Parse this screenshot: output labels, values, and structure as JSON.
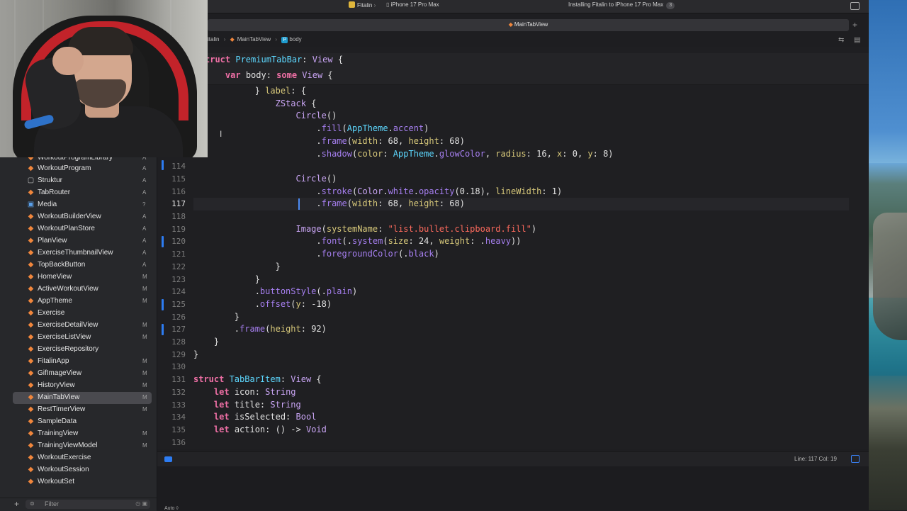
{
  "window": {
    "scheme": "Fitalin",
    "destination": "iPhone 17 Pro Max",
    "activity": "Installing Fitalin to iPhone 17 Pro Max",
    "activity_count": "3"
  },
  "tab": {
    "title": "MainTabView"
  },
  "jumpbar": {
    "project": "italin",
    "file": "MainTabView",
    "symbol": "body",
    "symbol_icon": "P"
  },
  "sidebar": {
    "items": [
      {
        "name": "WorkoutProgramLibrary",
        "status": "A",
        "kind": "swift"
      },
      {
        "name": "WorkoutProgram",
        "status": "A",
        "kind": "swift"
      },
      {
        "name": "Struktur",
        "status": "A",
        "kind": "folder"
      },
      {
        "name": "TabRouter",
        "status": "A",
        "kind": "swift"
      },
      {
        "name": "Media",
        "status": "?",
        "kind": "asset"
      },
      {
        "name": "WorkoutBuilderView",
        "status": "A",
        "kind": "swift"
      },
      {
        "name": "WorkoutPlanStore",
        "status": "A",
        "kind": "swift"
      },
      {
        "name": "PlanView",
        "status": "A",
        "kind": "swift"
      },
      {
        "name": "ExerciseThumbnailView",
        "status": "A",
        "kind": "swift"
      },
      {
        "name": "TopBackButton",
        "status": "A",
        "kind": "swift"
      },
      {
        "name": "HomeView",
        "status": "M",
        "kind": "swift"
      },
      {
        "name": "ActiveWorkoutView",
        "status": "M",
        "kind": "swift"
      },
      {
        "name": "AppTheme",
        "status": "M",
        "kind": "swift"
      },
      {
        "name": "Exercise",
        "status": "",
        "kind": "swift"
      },
      {
        "name": "ExerciseDetailView",
        "status": "M",
        "kind": "swift"
      },
      {
        "name": "ExerciseListView",
        "status": "M",
        "kind": "swift"
      },
      {
        "name": "ExerciseRepository",
        "status": "",
        "kind": "swift"
      },
      {
        "name": "FitalinApp",
        "status": "M",
        "kind": "swift"
      },
      {
        "name": "GifImageView",
        "status": "M",
        "kind": "swift"
      },
      {
        "name": "HistoryView",
        "status": "M",
        "kind": "swift"
      },
      {
        "name": "MainTabView",
        "status": "M",
        "kind": "swift",
        "selected": true
      },
      {
        "name": "RestTimerView",
        "status": "M",
        "kind": "swift"
      },
      {
        "name": "SampleData",
        "status": "",
        "kind": "swift"
      },
      {
        "name": "TrainingView",
        "status": "M",
        "kind": "swift"
      },
      {
        "name": "TrainingViewModel",
        "status": "M",
        "kind": "swift"
      },
      {
        "name": "WorkoutExercise",
        "status": "",
        "kind": "swift"
      },
      {
        "name": "WorkoutSession",
        "status": "",
        "kind": "swift"
      },
      {
        "name": "WorkoutSet",
        "status": "",
        "kind": "swift"
      }
    ],
    "filter_placeholder": "Filter"
  },
  "sticky_header": [
    [
      [
        "kw",
        "truct "
      ],
      [
        "ty",
        "PremiumTabBar"
      ],
      [
        "pl",
        ": "
      ],
      [
        "tp",
        "View"
      ],
      [
        "pl",
        " {"
      ]
    ],
    [
      [
        "pl",
        "    "
      ],
      [
        "kw",
        "var "
      ],
      [
        "pl",
        "body: "
      ],
      [
        "kw",
        "some "
      ],
      [
        "tp",
        "View"
      ],
      [
        "pl",
        " {"
      ]
    ]
  ],
  "code_lines": [
    {
      "n": "",
      "seg": [
        [
          "pl",
          "            } "
        ],
        [
          "nm",
          "label"
        ],
        [
          "pl",
          ": {"
        ]
      ]
    },
    {
      "n": "",
      "seg": [
        [
          "pl",
          "                "
        ],
        [
          "tp",
          "ZStack"
        ],
        [
          "pl",
          " {"
        ]
      ]
    },
    {
      "n": "",
      "seg": [
        [
          "pl",
          "                    "
        ],
        [
          "tp",
          "Circle"
        ],
        [
          "pl",
          "()"
        ]
      ]
    },
    {
      "n": "",
      "seg": [
        [
          "pl",
          "                        ."
        ],
        [
          "mt",
          "fill"
        ],
        [
          "pl",
          "("
        ],
        [
          "ty",
          "AppTheme"
        ],
        [
          "pl",
          "."
        ],
        [
          "mt",
          "accent"
        ],
        [
          "pl",
          ")"
        ]
      ]
    },
    {
      "n": "",
      "seg": [
        [
          "pl",
          "                        ."
        ],
        [
          "mt",
          "frame"
        ],
        [
          "pl",
          "("
        ],
        [
          "nm",
          "width"
        ],
        [
          "pl",
          ": 68, "
        ],
        [
          "nm",
          "height"
        ],
        [
          "pl",
          ": 68)"
        ]
      ]
    },
    {
      "n": "",
      "seg": [
        [
          "pl",
          "                        ."
        ],
        [
          "mt",
          "shadow"
        ],
        [
          "pl",
          "("
        ],
        [
          "nm",
          "color"
        ],
        [
          "pl",
          ": "
        ],
        [
          "ty",
          "AppTheme"
        ],
        [
          "pl",
          "."
        ],
        [
          "mt",
          "glowColor"
        ],
        [
          "pl",
          ", "
        ],
        [
          "nm",
          "radius"
        ],
        [
          "pl",
          ": 16, "
        ],
        [
          "nm",
          "x"
        ],
        [
          "pl",
          ": 0, "
        ],
        [
          "nm",
          "y"
        ],
        [
          "pl",
          ": 8)"
        ]
      ]
    },
    {
      "n": "114",
      "seg": []
    },
    {
      "n": "115",
      "seg": [
        [
          "pl",
          "                    "
        ],
        [
          "tp",
          "Circle"
        ],
        [
          "pl",
          "()"
        ]
      ]
    },
    {
      "n": "116",
      "seg": [
        [
          "pl",
          "                        ."
        ],
        [
          "mt",
          "stroke"
        ],
        [
          "pl",
          "("
        ],
        [
          "tp",
          "Color"
        ],
        [
          "pl",
          "."
        ],
        [
          "mt",
          "white"
        ],
        [
          "pl",
          "."
        ],
        [
          "mt",
          "opacity"
        ],
        [
          "pl",
          "(0.18), "
        ],
        [
          "nm",
          "lineWidth"
        ],
        [
          "pl",
          ": 1)"
        ]
      ]
    },
    {
      "n": "117",
      "seg": [
        [
          "pl",
          "                        ."
        ],
        [
          "mt",
          "frame"
        ],
        [
          "pl",
          "("
        ],
        [
          "nm",
          "width"
        ],
        [
          "pl",
          ": 68, "
        ],
        [
          "nm",
          "height"
        ],
        [
          "pl",
          ": 68)"
        ]
      ],
      "current": true
    },
    {
      "n": "118",
      "seg": []
    },
    {
      "n": "119",
      "seg": [
        [
          "pl",
          "                    "
        ],
        [
          "tp",
          "Image"
        ],
        [
          "pl",
          "("
        ],
        [
          "nm",
          "systemName"
        ],
        [
          "pl",
          ": "
        ],
        [
          "st",
          "\"list.bullet.clipboard.fill\""
        ],
        [
          "pl",
          ")"
        ]
      ]
    },
    {
      "n": "120",
      "seg": [
        [
          "pl",
          "                        ."
        ],
        [
          "mt",
          "font"
        ],
        [
          "pl",
          "(."
        ],
        [
          "mt",
          "system"
        ],
        [
          "pl",
          "("
        ],
        [
          "nm",
          "size"
        ],
        [
          "pl",
          ": 24, "
        ],
        [
          "nm",
          "weight"
        ],
        [
          "pl",
          ": ."
        ],
        [
          "mt",
          "heavy"
        ],
        [
          "pl",
          "))"
        ]
      ]
    },
    {
      "n": "121",
      "seg": [
        [
          "pl",
          "                        ."
        ],
        [
          "mt",
          "foregroundColor"
        ],
        [
          "pl",
          "(."
        ],
        [
          "mt",
          "black"
        ],
        [
          "pl",
          ")"
        ]
      ]
    },
    {
      "n": "122",
      "seg": [
        [
          "pl",
          "                }"
        ]
      ]
    },
    {
      "n": "123",
      "seg": [
        [
          "pl",
          "            }"
        ]
      ]
    },
    {
      "n": "124",
      "seg": [
        [
          "pl",
          "            ."
        ],
        [
          "mt",
          "buttonStyle"
        ],
        [
          "pl",
          "(."
        ],
        [
          "mt",
          "plain"
        ],
        [
          "pl",
          ")"
        ]
      ]
    },
    {
      "n": "125",
      "seg": [
        [
          "pl",
          "            ."
        ],
        [
          "mt",
          "offset"
        ],
        [
          "pl",
          "("
        ],
        [
          "nm",
          "y"
        ],
        [
          "pl",
          ": -18)"
        ]
      ]
    },
    {
      "n": "126",
      "seg": [
        [
          "pl",
          "        }"
        ]
      ]
    },
    {
      "n": "127",
      "seg": [
        [
          "pl",
          "        ."
        ],
        [
          "mt",
          "frame"
        ],
        [
          "pl",
          "("
        ],
        [
          "nm",
          "height"
        ],
        [
          "pl",
          ": 92)"
        ]
      ]
    },
    {
      "n": "128",
      "seg": [
        [
          "pl",
          "    }"
        ]
      ]
    },
    {
      "n": "129",
      "seg": [
        [
          "pl",
          "}"
        ]
      ]
    },
    {
      "n": "130",
      "seg": []
    },
    {
      "n": "131",
      "seg": [
        [
          "kw",
          "struct "
        ],
        [
          "ty",
          "TabBarItem"
        ],
        [
          "pl",
          ": "
        ],
        [
          "tp",
          "View"
        ],
        [
          "pl",
          " {"
        ]
      ]
    },
    {
      "n": "132",
      "seg": [
        [
          "pl",
          "    "
        ],
        [
          "kw",
          "let "
        ],
        [
          "pl",
          "icon: "
        ],
        [
          "tp",
          "String"
        ]
      ]
    },
    {
      "n": "133",
      "seg": [
        [
          "pl",
          "    "
        ],
        [
          "kw",
          "let "
        ],
        [
          "pl",
          "title: "
        ],
        [
          "tp",
          "String"
        ]
      ]
    },
    {
      "n": "134",
      "seg": [
        [
          "pl",
          "    "
        ],
        [
          "kw",
          "let "
        ],
        [
          "pl",
          "isSelected: "
        ],
        [
          "tp",
          "Bool"
        ]
      ]
    },
    {
      "n": "135",
      "seg": [
        [
          "pl",
          "    "
        ],
        [
          "kw",
          "let "
        ],
        [
          "pl",
          "action: () -> "
        ],
        [
          "tp",
          "Void"
        ]
      ]
    },
    {
      "n": "136",
      "seg": []
    }
  ],
  "status": {
    "position": "Line: 117  Col: 19"
  },
  "console": {
    "filter_mode": "Auto ◊"
  },
  "colors": {
    "accent": "#2d7cf2",
    "swift_icon": "#f0863c",
    "keyword": "#ee6fa5",
    "type": "#5dd8ff"
  }
}
